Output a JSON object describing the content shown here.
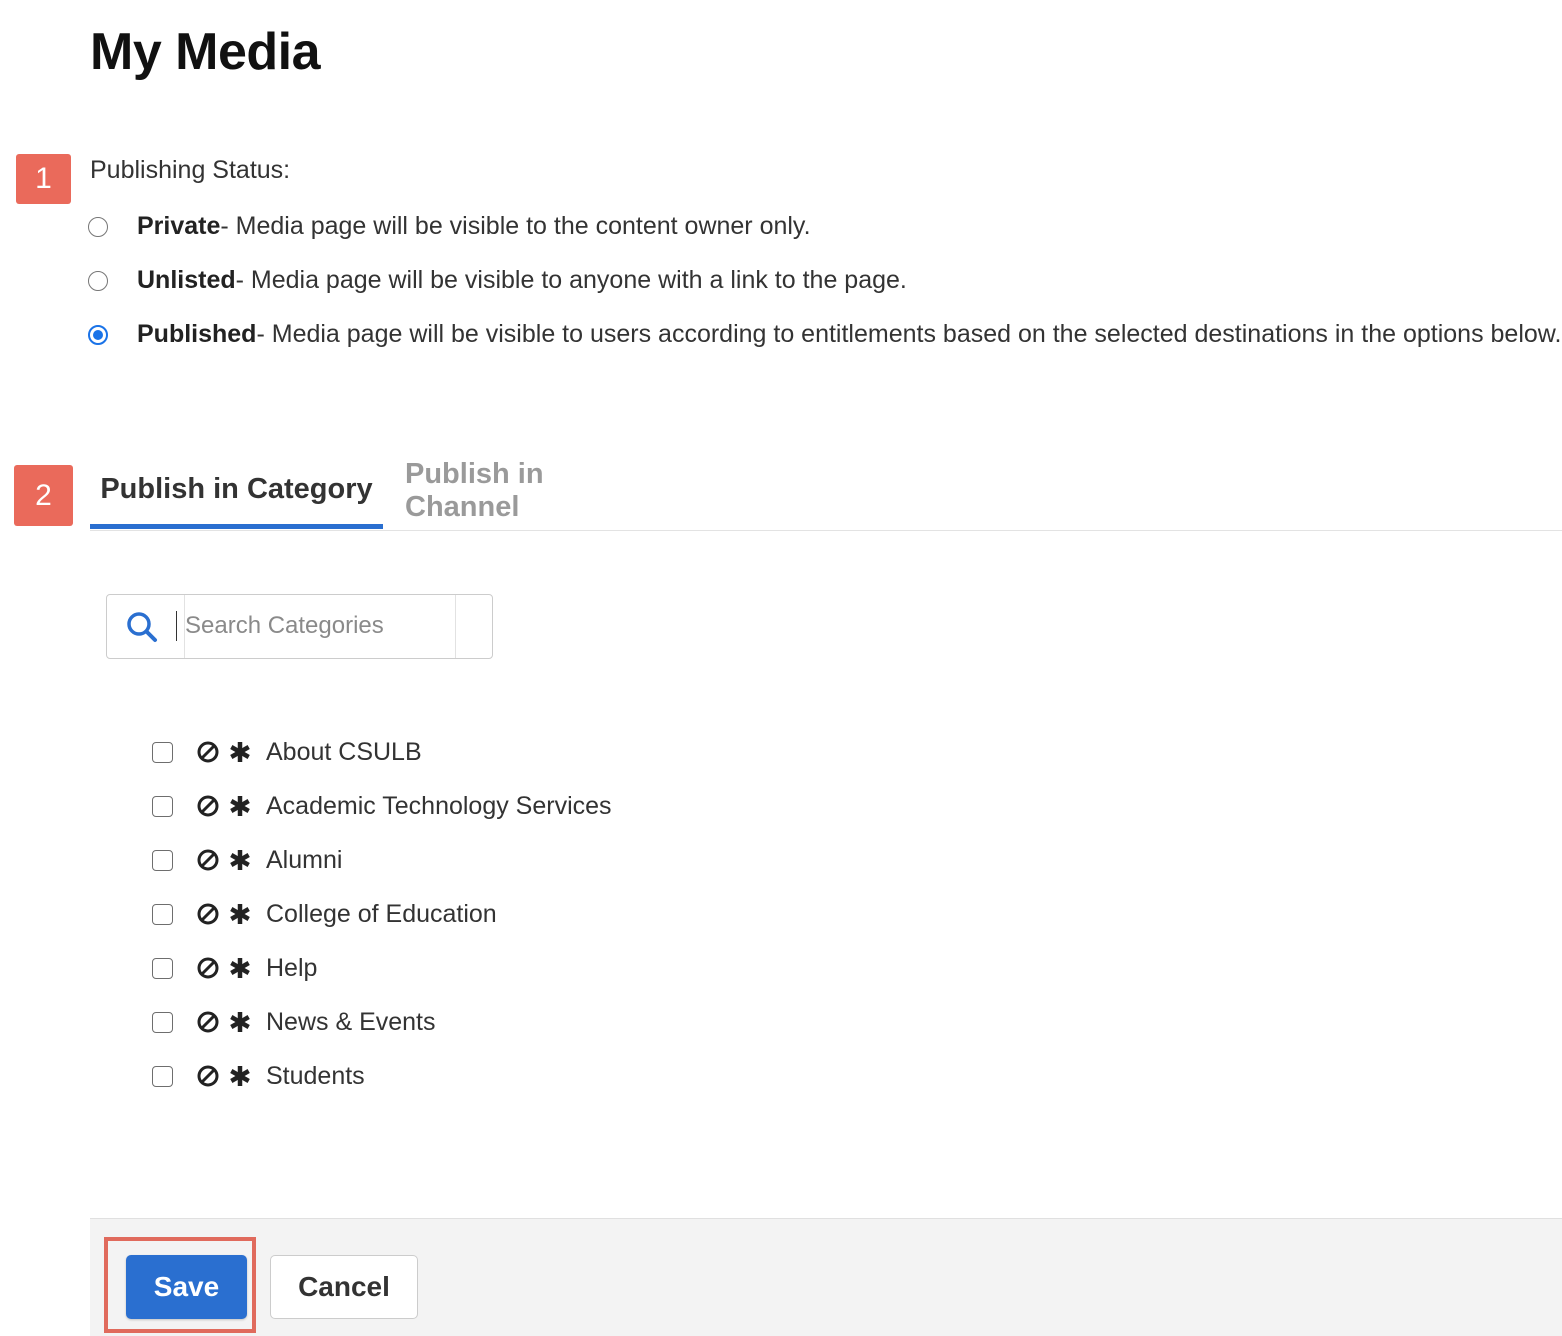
{
  "page": {
    "title": "My Media"
  },
  "steps": {
    "step1": "1",
    "step2": "2"
  },
  "publishing_status": {
    "label": "Publishing Status:",
    "options": [
      {
        "name": "Private",
        "description": " - Media page will be visible to the content owner only.",
        "checked": false
      },
      {
        "name": "Unlisted",
        "description": " - Media page will be visible to anyone with a link to the page.",
        "checked": false
      },
      {
        "name": "Published",
        "description": " - Media page will be visible to users according to entitlements based on the selected destinations in the options below.",
        "checked": true
      }
    ]
  },
  "tabs": [
    {
      "label": "Publish in Category",
      "active": true
    },
    {
      "label": "Publish in Channel",
      "active": false
    }
  ],
  "search": {
    "placeholder": "Search Categories",
    "value": "",
    "icon": "search-icon"
  },
  "categories": [
    {
      "label": "About CSULB",
      "checked": false,
      "icons": [
        "ban-icon",
        "asterisk-icon"
      ]
    },
    {
      "label": "Academic Technology Services",
      "checked": false,
      "icons": [
        "ban-icon",
        "asterisk-icon"
      ]
    },
    {
      "label": "Alumni",
      "checked": false,
      "icons": [
        "ban-icon",
        "asterisk-icon"
      ]
    },
    {
      "label": "College of Education",
      "checked": false,
      "icons": [
        "ban-icon",
        "asterisk-icon"
      ]
    },
    {
      "label": "Help",
      "checked": false,
      "icons": [
        "ban-icon",
        "asterisk-icon"
      ]
    },
    {
      "label": "News & Events",
      "checked": false,
      "icons": [
        "ban-icon",
        "asterisk-icon"
      ]
    },
    {
      "label": "Students",
      "checked": false,
      "icons": [
        "ban-icon",
        "asterisk-icon"
      ]
    }
  ],
  "actions": {
    "save_label": "Save",
    "cancel_label": "Cancel"
  },
  "colors": {
    "accent": "#2a6fd0",
    "step_badge": "#ea6a5b",
    "highlight": "#e06a5c",
    "radio_selected": "#1a73e8",
    "inactive_tab": "#9a9a9a"
  }
}
